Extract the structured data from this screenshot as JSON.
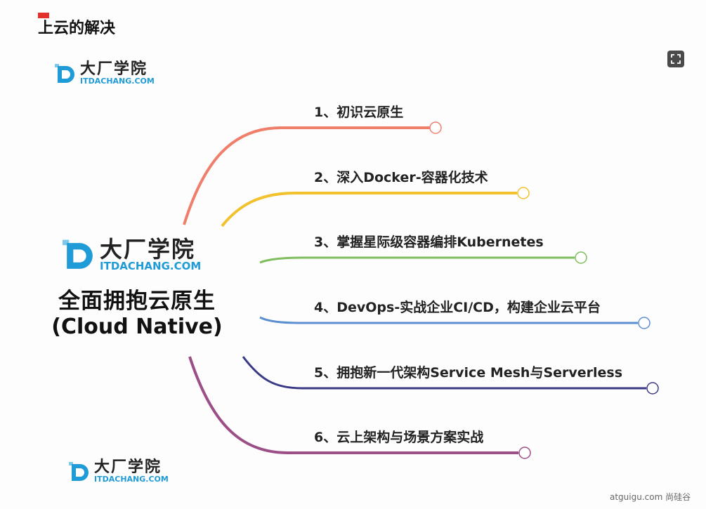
{
  "slide": {
    "title": "上云的解决"
  },
  "logo": {
    "brand": "大厂学院",
    "domain": "ITDACHANG.COM",
    "color": "#1f9bd7"
  },
  "center": {
    "title": "全面拥抱云原生",
    "subtitle": "(Cloud Native)"
  },
  "branches": [
    {
      "label": "1、初识云原生",
      "color": "#ef7f6a"
    },
    {
      "label": "2、深入Docker-容器化技术",
      "color": "#f2c12e"
    },
    {
      "label": "3、掌握星际级容器编排Kubernetes",
      "color": "#7dbd5b"
    },
    {
      "label": "4、DevOps-实战企业CI/CD，构建企业云平台",
      "color": "#5b8fcf"
    },
    {
      "label": "5、拥抱新一代架构Service Mesh与Serverless",
      "color": "#3b3a86"
    },
    {
      "label": "6、云上架构与场景方案实战",
      "color": "#9c4e86"
    }
  ],
  "footer": {
    "watermark": "atguigu.com 尚硅谷"
  }
}
